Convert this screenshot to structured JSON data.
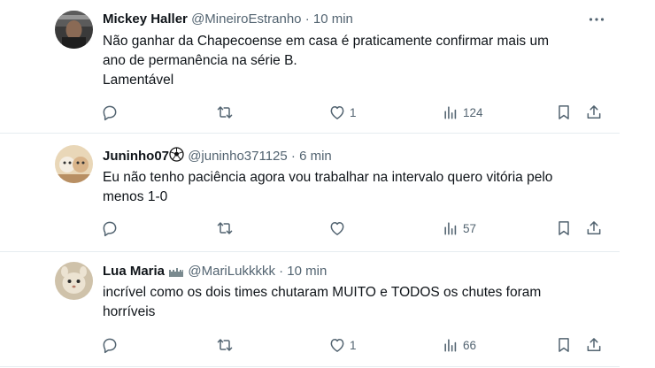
{
  "posts": [
    {
      "name": "Mickey Haller",
      "handle": "@MineiroEstranho",
      "dot": "·",
      "time": "10 min",
      "lines": [
        "Não ganhar da Chapecoense em casa é praticamente confirmar mais um",
        "ano de permanência na série B.",
        "Lamentável"
      ],
      "replies": "",
      "reposts": "",
      "likes": "1",
      "views": "124"
    },
    {
      "name": "Juninho07",
      "handle": "@juninho371125",
      "dot": "·",
      "time": "6 min",
      "lines": [
        "Eu não tenho paciência agora vou trabalhar na intervalo quero vitória pelo",
        "menos 1-0"
      ],
      "replies": "",
      "reposts": "",
      "likes": "",
      "views": "57"
    },
    {
      "name": "Lua Maria",
      "handle": "@MariLukkkkk",
      "dot": "·",
      "time": "10 min",
      "lines": [
        "incrível como os dois times chutaram MUITO e TODOS os chutes foram",
        "horríveis"
      ],
      "replies": "",
      "reposts": "",
      "likes": "1",
      "views": "66"
    }
  ],
  "icons": {
    "reply": "reply-icon",
    "repost": "repost-icon",
    "like": "heart-icon",
    "views": "views-icon",
    "bookmark": "bookmark-icon",
    "share": "share-icon",
    "more": "more-icon"
  },
  "colors": {
    "text": "#0f1419",
    "secondary": "#536471",
    "divider": "#e6ecf0"
  }
}
